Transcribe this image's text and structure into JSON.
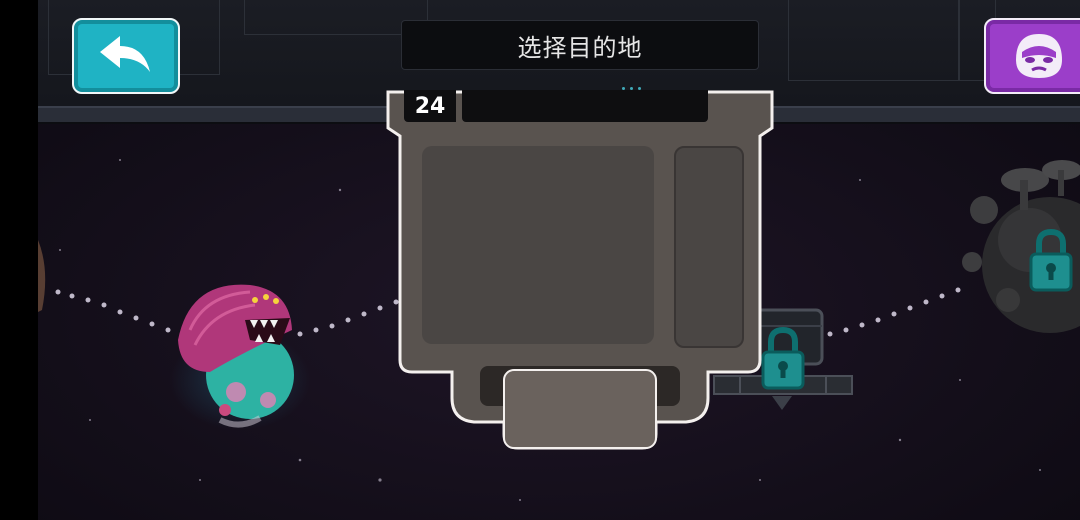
{
  "header": {
    "title": "选择目的地"
  },
  "device": {
    "number": "24"
  },
  "buttons": {
    "back_icon": "back-arrow-icon",
    "avatar_icon": "astronaut-face-icon"
  },
  "map": {
    "planets": [
      {
        "name": "monster-planet",
        "locked": false
      },
      {
        "name": "satellite-station",
        "locked": true
      },
      {
        "name": "mushroom-planet",
        "locked": true
      }
    ]
  },
  "colors": {
    "back_button": "#1fb3c4",
    "avatar_button": "#9b3ec9",
    "lock": "#1e8f8f",
    "space_bg": "#120d18"
  }
}
